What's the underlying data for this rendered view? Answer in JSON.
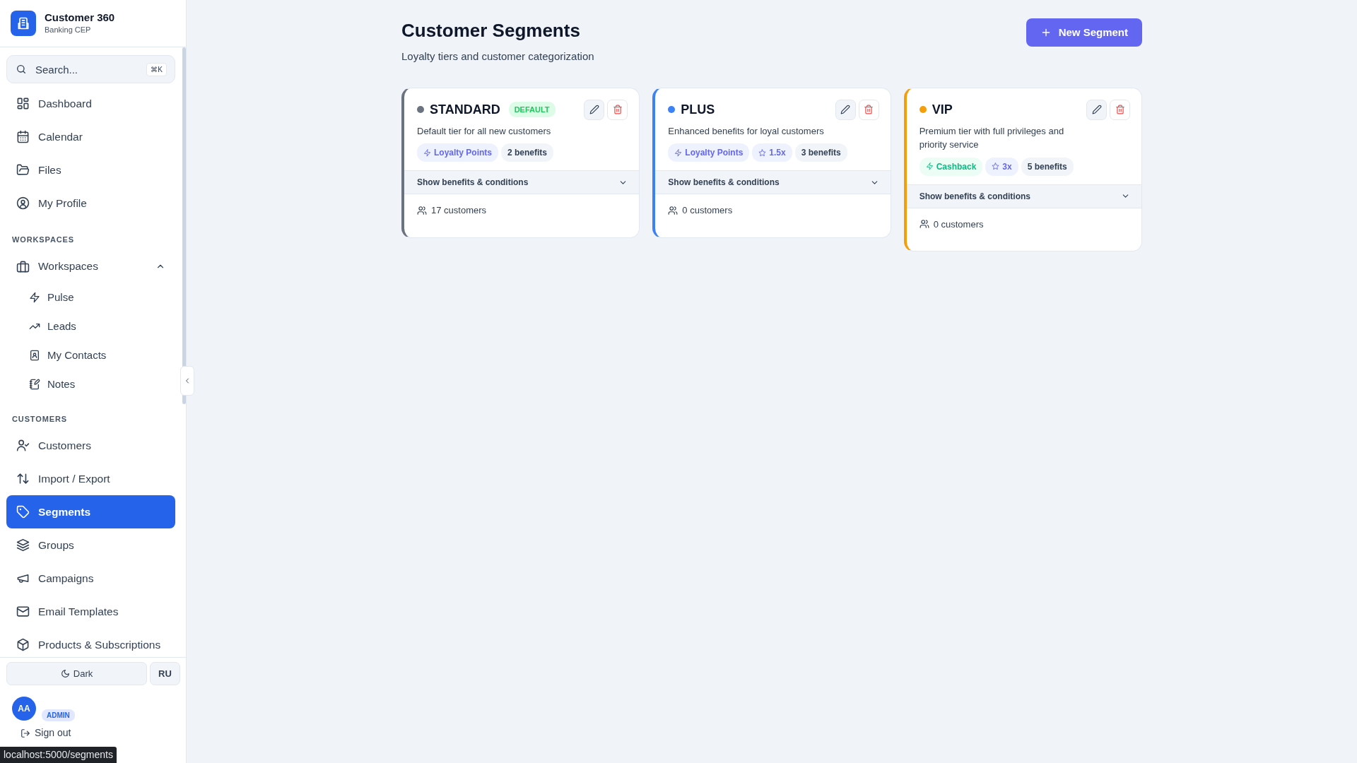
{
  "app": {
    "name": "Customer 360",
    "subtitle": "Banking CEP"
  },
  "search": {
    "placeholder": "Search...",
    "shortcut": "⌘K"
  },
  "nav": [
    {
      "label": "Dashboard",
      "selected": false
    },
    {
      "label": "Calendar",
      "selected": false
    },
    {
      "label": "Files",
      "selected": false
    },
    {
      "label": "My Profile",
      "selected": false
    }
  ],
  "workspaces_section": {
    "title": "WORKSPACES",
    "group": {
      "label": "Workspaces",
      "expanded": true,
      "children": [
        {
          "label": "Pulse",
          "selected": false
        },
        {
          "label": "Leads",
          "selected": false
        },
        {
          "label": "My Contacts",
          "selected": false
        },
        {
          "label": "Notes",
          "selected": false
        }
      ]
    }
  },
  "customers_section": {
    "title": "CUSTOMERS",
    "items": [
      {
        "label": "Customers",
        "selected": false
      },
      {
        "label": "Import / Export",
        "selected": false
      },
      {
        "label": "Segments",
        "selected": true
      },
      {
        "label": "Groups",
        "selected": false
      },
      {
        "label": "Campaigns",
        "selected": false
      },
      {
        "label": "Email Templates",
        "selected": false
      },
      {
        "label": "Products & Subscriptions",
        "selected": false
      }
    ]
  },
  "footer": {
    "theme_button": "Dark",
    "language_button": "RU",
    "user": {
      "initials": "AA",
      "role": "ADMIN"
    },
    "sign_out": "Sign out"
  },
  "status_url": "localhost:5000/segments",
  "page": {
    "title": "Customer Segments",
    "subtitle": "Loyalty tiers and customer categorization",
    "new_button": "New Segment"
  },
  "segments": [
    {
      "name": "STANDARD",
      "color": "#6b7280",
      "badge": "DEFAULT",
      "description": "Default tier for all new customers",
      "tags": [
        {
          "kind": "points",
          "label": "Loyalty Points"
        },
        {
          "kind": "count",
          "label": "2 benefits"
        }
      ],
      "toggle_label": "Show benefits & conditions",
      "expanded": false,
      "customers": "17 customers"
    },
    {
      "name": "PLUS",
      "color": "#3b82f6",
      "description": "Enhanced benefits for loyal customers",
      "tags": [
        {
          "kind": "points",
          "label": "Loyalty Points"
        },
        {
          "kind": "multiplier",
          "label": "1.5x"
        },
        {
          "kind": "count",
          "label": "3 benefits"
        }
      ],
      "toggle_label": "Show benefits & conditions",
      "expanded": false,
      "customers": "0 customers"
    },
    {
      "name": "VIP",
      "color": "#f59e0b",
      "description": "Premium tier with full privileges and priority service",
      "tags": [
        {
          "kind": "cashback",
          "label": "Cashback"
        },
        {
          "kind": "multiplier",
          "label": "3x"
        },
        {
          "kind": "count",
          "label": "5 benefits"
        }
      ],
      "toggle_label": "Show benefits & conditions",
      "expanded": false,
      "customers": "0 customers"
    }
  ]
}
